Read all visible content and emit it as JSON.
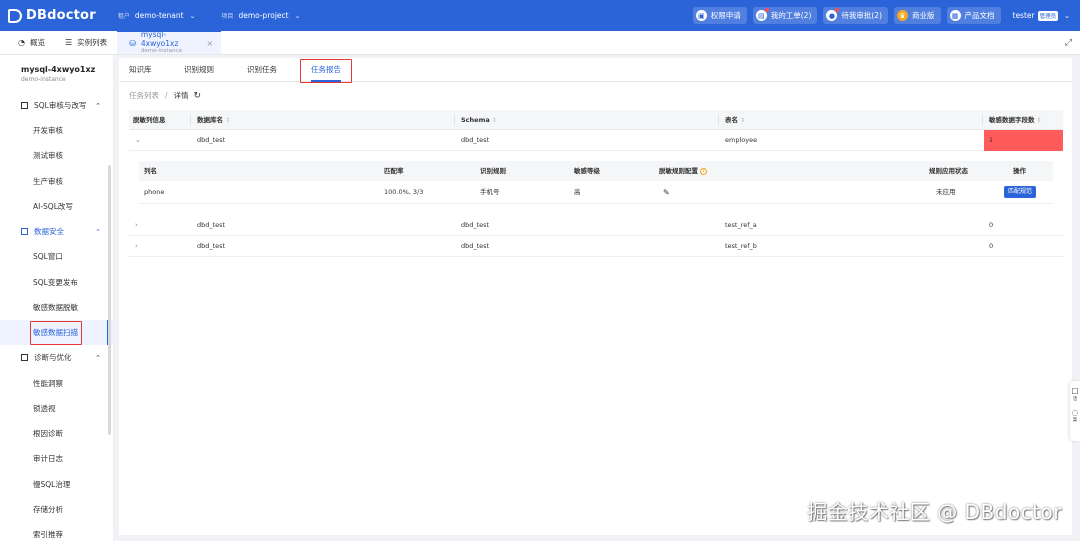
{
  "header": {
    "logo_text": "DBdoctor",
    "tenant_label": "租户",
    "tenant_value": "demo-tenant",
    "project_label": "项目",
    "project_value": "demo-project",
    "actions": [
      {
        "label": "权限申请",
        "icon": "lock-icon"
      },
      {
        "label": "我的工单(2)",
        "icon": "ticket-icon"
      },
      {
        "label": "待我审批(2)",
        "icon": "approval-icon"
      },
      {
        "label": "商业版",
        "icon": "crown-icon"
      },
      {
        "label": "产品文档",
        "icon": "doc-icon"
      }
    ],
    "user_name": "tester",
    "user_role": "管理员"
  },
  "tabs": {
    "overview": "概览",
    "instances": "实例列表",
    "active_title": "mysql-4xwyo1xz",
    "active_sub": "demo-instance"
  },
  "sidebar": {
    "instance_name": "mysql-4xwyo1xz",
    "instance_sub": "demo-instance",
    "group1": "SQL审核与改写",
    "group1_items": [
      "开发审核",
      "测试审核",
      "生产审核",
      "AI-SQL改写"
    ],
    "group2": "数据安全",
    "group2_items": [
      "SQL窗口",
      "SQL变更发布",
      "敏感数据脱敏",
      "敏感数据扫描"
    ],
    "group3": "诊断与优化",
    "group3_items": [
      "性能洞察",
      "锁透视",
      "根因诊断",
      "审计日志",
      "慢SQL治理",
      "存储分析",
      "索引推荐"
    ]
  },
  "content_tabs": [
    "知识库",
    "识别规则",
    "识别任务",
    "任务报告"
  ],
  "breadcrumb": {
    "parent": "任务列表",
    "sep": "/",
    "current": "详情"
  },
  "table": {
    "headers": [
      "脱敏列信息",
      "数据库名",
      "Schema",
      "表名",
      "敏感数据字段数"
    ],
    "rows": [
      {
        "db": "dbd_test",
        "schema": "dbd_test",
        "table": "employee",
        "count": "1",
        "expanded": true
      },
      {
        "db": "dbd_test",
        "schema": "dbd_test",
        "table": "test_ref_a",
        "count": "0",
        "expanded": false
      },
      {
        "db": "dbd_test",
        "schema": "dbd_test",
        "table": "test_ref_b",
        "count": "0",
        "expanded": false
      }
    ]
  },
  "subtable": {
    "headers": [
      "列名",
      "匹配率",
      "识别规则",
      "敏感等级",
      "脱敏规则配置",
      "规则应用状态",
      "操作"
    ],
    "row": {
      "column": "phone",
      "match_rate": "100.0%, 3/3",
      "rule": "手机号",
      "level": "高",
      "status": "未应用",
      "action": "匹配规范"
    }
  },
  "float_dock": {
    "a": "活",
    "b": "案"
  },
  "watermark": "掘金技术社区 @ DBdoctor",
  "colors": {
    "brand": "#2b63d9",
    "highlight_red": "#ff5b5b",
    "box_red": "#e53935"
  }
}
